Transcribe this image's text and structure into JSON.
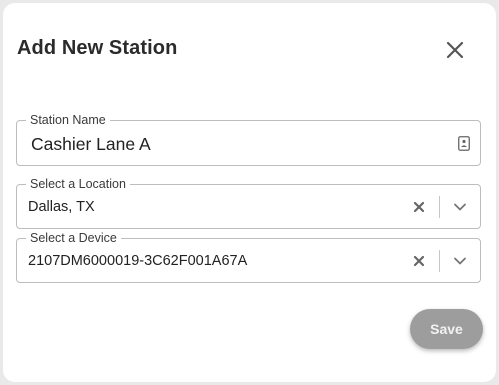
{
  "dialog": {
    "title": "Add New Station",
    "close_icon": "close-icon"
  },
  "fields": {
    "station_name": {
      "label": "Station Name",
      "value": "Cashier Lane A",
      "icon": "contact-card-icon"
    },
    "location": {
      "label": "Select a Location",
      "value": "Dallas, TX",
      "clear_icon": "clear-icon",
      "dropdown_icon": "chevron-down-icon"
    },
    "device": {
      "label": "Select a Device",
      "value": "2107DM6000019-3C62F001A67A",
      "clear_icon": "clear-icon",
      "dropdown_icon": "chevron-down-icon"
    }
  },
  "actions": {
    "save_label": "Save"
  },
  "colors": {
    "title": "#2b2b2b",
    "border": "#bdbdbd",
    "save_button_bg": "#9d9d9d",
    "save_button_text": "#f2f2f2",
    "background": "#e9e9e9"
  }
}
